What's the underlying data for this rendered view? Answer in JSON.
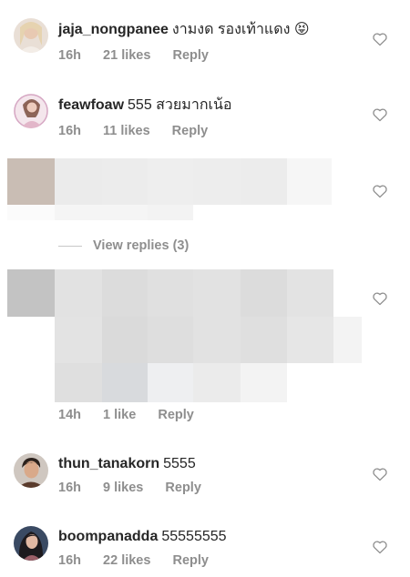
{
  "comments": [
    {
      "username": "jaja_nongpanee",
      "text": "งามงด รองเท้าแดง 😝",
      "time": "16h",
      "likes": "21 likes",
      "reply": "Reply"
    },
    {
      "username": "feawfoaw",
      "text": "555 สวยมากเน้อ",
      "time": "16h",
      "likes": "11 likes",
      "reply": "Reply"
    },
    {
      "time": "14h",
      "likes": "1 like",
      "reply": "Reply"
    },
    {
      "username": "thun_tanakorn",
      "text": "5555",
      "time": "16h",
      "likes": "9 likes",
      "reply": "Reply"
    },
    {
      "username": "boompanadda",
      "text": "55555555",
      "time": "16h",
      "likes": "22 likes",
      "reply": "Reply"
    }
  ],
  "view_replies": {
    "label": "View replies (3)"
  },
  "icons": {
    "like": "heart-outline-icon"
  },
  "colors": {
    "text": "#262626",
    "secondary": "#8e8e8e",
    "icon": "#8e8e8e"
  }
}
